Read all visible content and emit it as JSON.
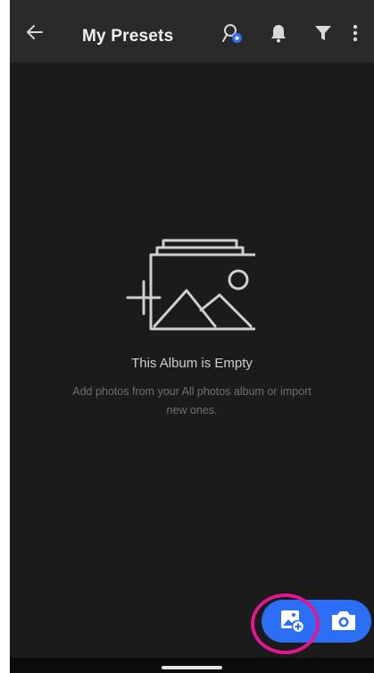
{
  "header": {
    "title": "My Presets"
  },
  "empty_state": {
    "title": "This Album is Empty",
    "subtitle": "Add photos from your All photos album or import new ones."
  },
  "icons": {
    "back": "back-arrow-icon",
    "people": "people-search-icon",
    "notifications": "bell-icon",
    "filter": "filter-icon",
    "more": "more-vertical-icon",
    "empty": "empty-album-icon",
    "import": "add-photo-icon",
    "camera": "camera-icon"
  },
  "colors": {
    "background": "#1b1b1b",
    "header": "#2a2a2a",
    "accent": "#2d6ef6",
    "highlight": "#e0178f"
  }
}
